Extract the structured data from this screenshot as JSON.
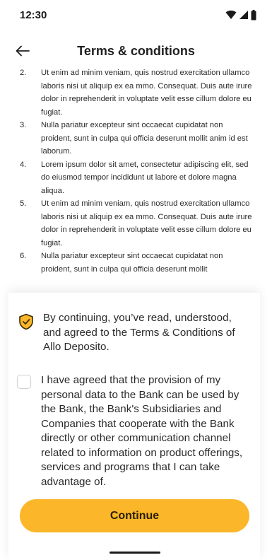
{
  "status_bar": {
    "time": "12:30",
    "icons": [
      "wifi-icon",
      "signal-icon",
      "battery-icon"
    ]
  },
  "app_bar": {
    "back_icon": "arrow-left-icon",
    "title": "Terms & conditions"
  },
  "terms": [
    {
      "num": "2.",
      "text": "Ut enim ad minim veniam, quis nostrud exercitation ullamco laboris nisi ut aliquip ex ea mmo. Consequat. Duis aute irure dolor in reprehenderit in voluptate velit esse cillum dolore eu fugiat."
    },
    {
      "num": "3.",
      "text": "Nulla pariatur excepteur sint occaecat cupidatat non proident, sunt in culpa qui officia deserunt mollit anim id est laborum."
    },
    {
      "num": "4.",
      "text": "Lorem ipsum dolor sit amet, consectetur adipiscing elit, sed do eiusmod tempor incididunt ut labore et dolore magna aliqua."
    },
    {
      "num": "5.",
      "text": "Ut enim ad minim veniam, quis nostrud exercitation ullamco laboris nisi ut aliquip ex ea mmo. Consequat. Duis aute irure dolor in reprehenderit in voluptate velit esse cillum dolore eu fugiat."
    },
    {
      "num": "6.",
      "text": "Nulla pariatur excepteur sint occaecat cupidatat non proident, sunt in culpa qui officia deserunt mollit"
    }
  ],
  "sheet": {
    "info_icon": "shield-check-icon",
    "info_text": "By continuing, you’ve read, understood, and agreed to the Terms & Conditions of Allo Deposito.",
    "consent_checked": false,
    "consent_text": "I have agreed that the provision of my personal data to the Bank can be used by the Bank, the Bank's Subsidiaries and Companies that cooperate with the Bank directly or other communication channel related to information on product offerings, services and programs that I can take advantage of.",
    "continue_label": "Continue"
  },
  "colors": {
    "accent": "#fbb62a",
    "shield_fill": "#fbb62a",
    "shield_stroke": "#3a2a00",
    "checkbox_border": "#cfcfcf"
  }
}
